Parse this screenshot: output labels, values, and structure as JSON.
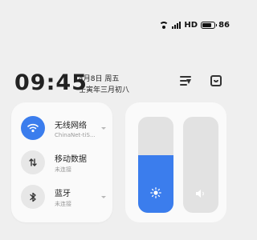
{
  "status_bar": {
    "network": "HD",
    "battery_level": "86",
    "icons": [
      "wifi-icon",
      "signal-icon",
      "battery-icon"
    ]
  },
  "clock": {
    "time": "09:45",
    "date": "4月8日 周五",
    "lunar_date": "壬寅年三月初八"
  },
  "top_actions": [
    "edit-list-icon",
    "notification-tray-icon"
  ],
  "connectivity": {
    "items": [
      {
        "label": "无线网络",
        "sub": "ChinaNet-tiS...",
        "active": true,
        "icon": "wifi-icon"
      },
      {
        "label": "移动数据",
        "sub": "未连接",
        "active": false,
        "icon": "mobile-data-icon"
      },
      {
        "label": "蓝牙",
        "sub": "未连接",
        "active": false,
        "icon": "bluetooth-icon"
      }
    ]
  },
  "sliders": {
    "brightness": {
      "level": 0.6,
      "icon": "sun-icon"
    },
    "volume": {
      "level": 0.0,
      "icon": "speaker-icon"
    }
  },
  "colors": {
    "accent": "#3b7ded",
    "card": "#fafafa",
    "background": "#efefef"
  }
}
